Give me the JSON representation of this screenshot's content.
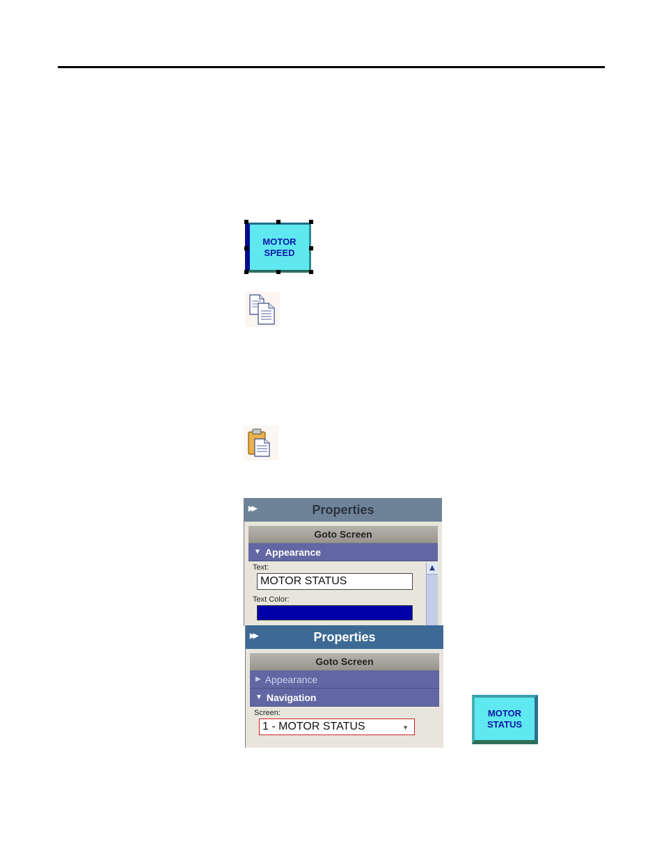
{
  "motor_speed_button": {
    "label": "MOTOR\nSPEED"
  },
  "copy_icon": {
    "icon": "copy-icon"
  },
  "paste_icon": {
    "icon": "paste-icon"
  },
  "properties_panel_appearance": {
    "title": "Properties",
    "section": "Goto Screen",
    "group": "Appearance",
    "text_label": "Text:",
    "text_value": "MOTOR STATUS",
    "text_color_label": "Text Color:",
    "text_color": "#0000a8"
  },
  "properties_panel_navigation": {
    "title": "Properties",
    "section": "Goto Screen",
    "appearance_group": "Appearance",
    "navigation_group": "Navigation",
    "screen_label": "Screen:",
    "screen_value": "1 - MOTOR STATUS"
  },
  "motor_status_button": {
    "label": "MOTOR\nSTATUS"
  },
  "colors": {
    "button_face": "#5fe8f0",
    "button_text": "#0a18a8",
    "panel_title_dark": "#3d6a95",
    "group_bar": "#6266a2"
  }
}
